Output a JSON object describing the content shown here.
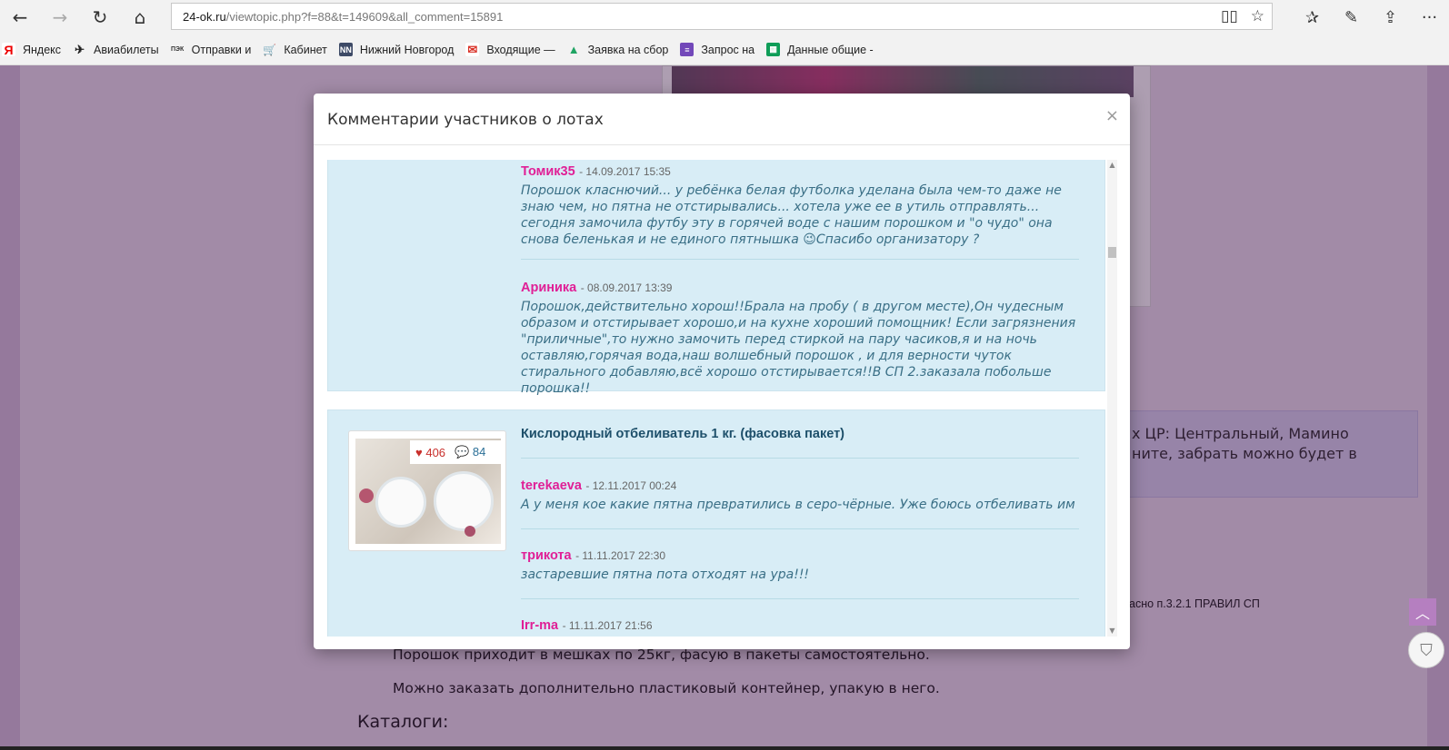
{
  "browser": {
    "url_host": "24-ok.ru",
    "url_path": "/viewtopic.php?f=88&t=149609&all_comment=15891",
    "bookmarks": [
      {
        "label": "Яндекс",
        "icon": "yandex-icon"
      },
      {
        "label": "Авиабилеты",
        "icon": "plane-icon"
      },
      {
        "label": "Отправки и",
        "icon": "cdek-icon"
      },
      {
        "label": "Кабинет",
        "icon": "cart-icon"
      },
      {
        "label": "Нижний Новгород",
        "icon": "nn-icon"
      },
      {
        "label": "Входящие —",
        "icon": "mail-icon"
      },
      {
        "label": "Заявка на сбор",
        "icon": "drive-icon"
      },
      {
        "label": "Запрос на",
        "icon": "forms-icon"
      },
      {
        "label": "Данные общие -",
        "icon": "sheets-icon"
      }
    ]
  },
  "modal": {
    "title": "Комментарии участников о лотах",
    "close": "×",
    "lot1": {
      "comments": [
        {
          "author": "Томик35",
          "date": "- 14.09.2017 15:35",
          "text": "Порошок класнючий... у ребёнка белая футболка уделана была чем-то даже не знаю чем, но пятна не отстирывались... хотела уже ее в утиль отправлять... сегодня замочила футбу эту в горячей воде с нашим порошком и \"о чудо\" она снова беленькая и не единого пятнышка 😉Спасибо организатору ?"
        },
        {
          "author": "Ариника",
          "date": "- 08.09.2017 13:39",
          "text": "Порошок,действительно хорош!!Брала на пробу ( в другом месте),Он чудесным образом и отстирывает хорошо,и на кухне хороший помощник! Если загрязнения \"приличные\",то нужно замочить перед стиркой на пару часиков,я и на ночь оставляю,горячая вода,наш волшебный порошок , и для верности чуток стирального добавляю,всё хорошо отстирывается!!В СП 2.заказала побольше порошка!!"
        }
      ]
    },
    "lot2": {
      "title": "Кислородный отбеливатель 1 кг. (фасовка пакет)",
      "likes": "406",
      "comment_count": "84",
      "comments": [
        {
          "author": "terekaeva",
          "date": "- 12.11.2017 00:24",
          "text": "А у меня кое какие пятна превратились в серо-чёрные. Уже боюсь отбеливать им"
        },
        {
          "author": "трикота",
          "date": "- 11.11.2017 22:30",
          "text": "застаревшие пятна пота отходят на ура!!!"
        },
        {
          "author": "Irr-ma",
          "date": "- 11.11.2017 21:56",
          "text": ""
        }
      ]
    }
  },
  "page": {
    "notice_line1": "х ЦР: Центральный, Мамино",
    "notice_line2": "ните, забрать можно будет в",
    "rule_note": "асно п.3.2.1 ПРАВИЛ СП",
    "text1": "Порошок приходит в мешках по 25кг, фасую в пакеты самостоятельно.",
    "text2": "Можно заказать дополнительно пластиковый контейнер, упакую в него.",
    "catalogs": "Каталоги:"
  }
}
